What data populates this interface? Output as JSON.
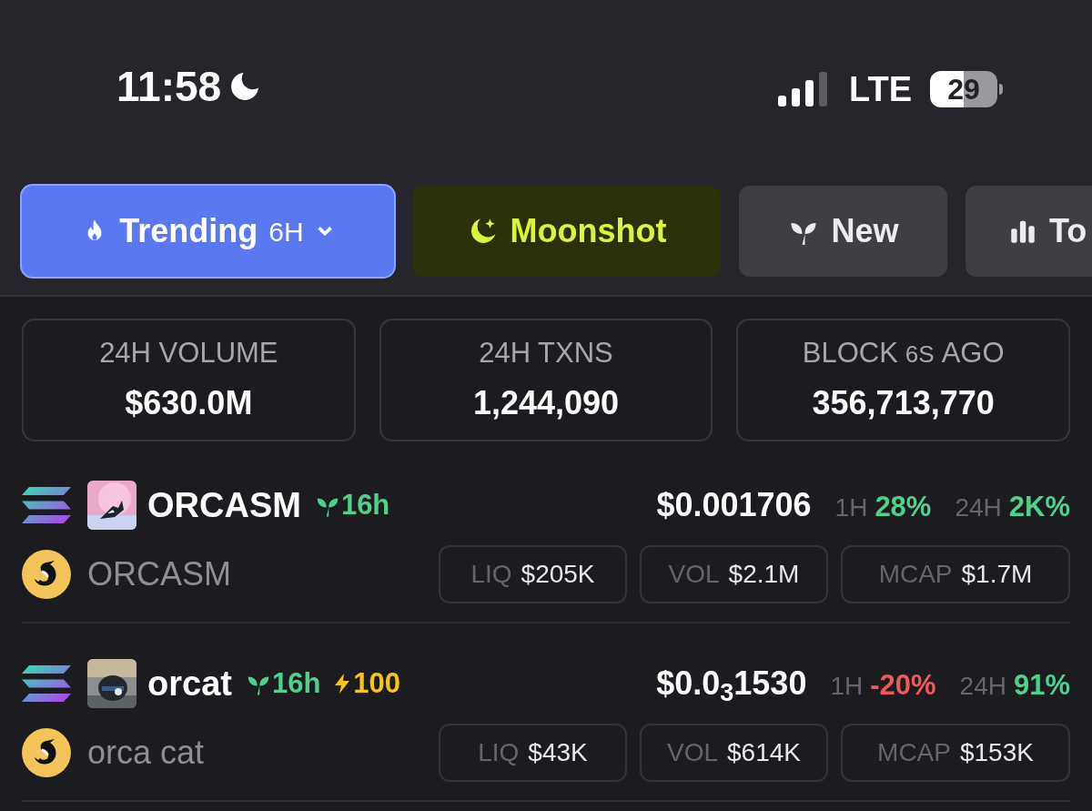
{
  "status_bar": {
    "time": "11:58",
    "network": "LTE",
    "battery": "29"
  },
  "tabs": [
    {
      "label": "Trending",
      "suffix": "6H",
      "kind": "trending",
      "selected": true
    },
    {
      "label": "Moonshot",
      "kind": "moonshot",
      "selected": false
    },
    {
      "label": "New",
      "kind": "new",
      "selected": false
    },
    {
      "label": "To",
      "kind": "top",
      "selected": false
    }
  ],
  "stats": [
    {
      "label": "24H VOLUME",
      "value": "$630.0M"
    },
    {
      "label": "24H TXNS",
      "value": "1,244,090"
    },
    {
      "label": "BLOCK",
      "label_small": "6S",
      "label_suffix": "AGO",
      "value": "356,713,770"
    }
  ],
  "tokens": [
    {
      "symbol": "ORCASM",
      "name": "ORCASM",
      "age": "16h",
      "price": "$0.001706",
      "changes": [
        {
          "period": "1H",
          "value": "28%",
          "negative": false
        },
        {
          "period": "24H",
          "value": "2K%",
          "negative": false
        }
      ],
      "metrics": [
        {
          "label": "LIQ",
          "value": "$205K"
        },
        {
          "label": "VOL",
          "value": "$2.1M"
        },
        {
          "label": "MCAP",
          "value": "$1.7M"
        }
      ]
    },
    {
      "symbol": "orcat",
      "name": "orca cat",
      "age": "16h",
      "boost": "100",
      "price": "$0.0$_{3}$1530",
      "changes": [
        {
          "period": "1H",
          "value": "-20%",
          "negative": true
        },
        {
          "period": "24H",
          "value": "91%",
          "negative": false
        }
      ],
      "metrics": [
        {
          "label": "LIQ",
          "value": "$43K"
        },
        {
          "label": "VOL",
          "value": "$614K"
        },
        {
          "label": "MCAP",
          "value": "$153K"
        }
      ]
    }
  ]
}
